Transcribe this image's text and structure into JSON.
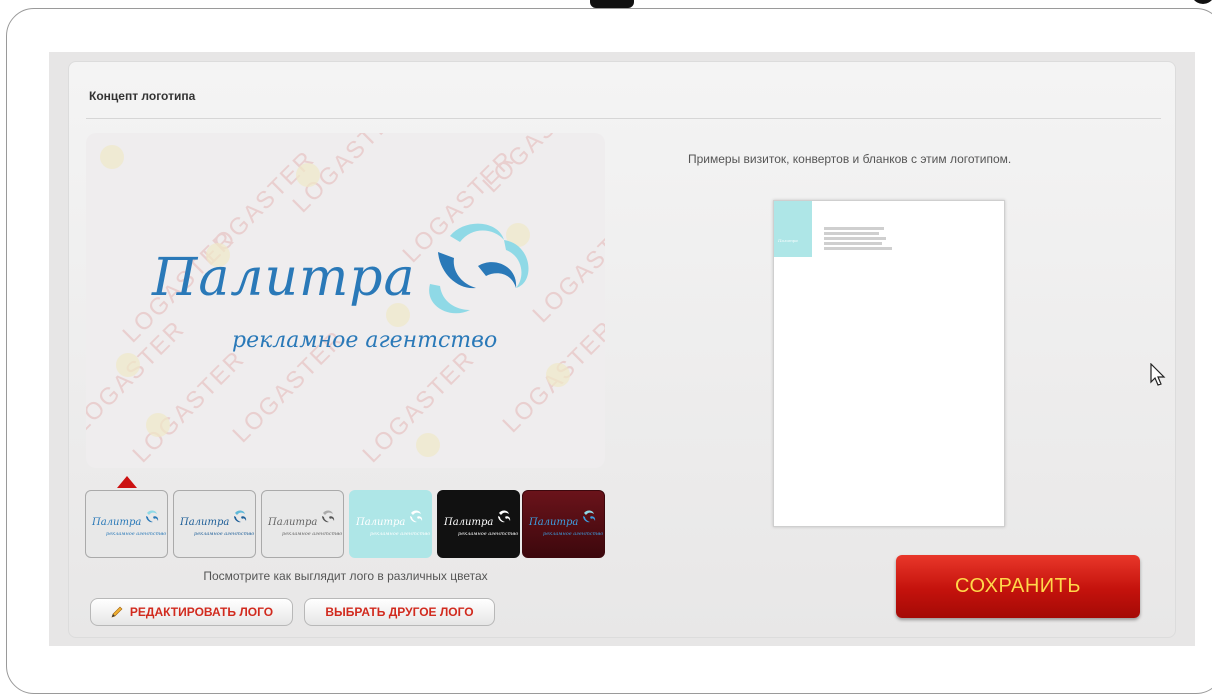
{
  "panel": {
    "title": "Концепт логотипа"
  },
  "preview": {
    "watermark_text": "LOGASTER",
    "logo_name": "Палитра",
    "logo_tagline": "рекламное агентство"
  },
  "variants": {
    "caption": "Посмотрите как выглядит лого в различных цветах",
    "items": [
      {
        "logo_name": "Палитра",
        "logo_tagline": "рекламное агентство",
        "background": "#e8e8e8",
        "text_color": "#2a79b8"
      },
      {
        "logo_name": "Палитра",
        "logo_tagline": "рекламное агентство",
        "background": "#e8e8e8",
        "text_color": "#1f5f98"
      },
      {
        "logo_name": "Палитра",
        "logo_tagline": "рекламное агентство",
        "background": "#e8e8e8",
        "text_color": "#666666"
      },
      {
        "logo_name": "Палитра",
        "logo_tagline": "рекламное агентство",
        "background": "#aee6e7",
        "text_color": "#ffffff"
      },
      {
        "logo_name": "Палитра",
        "logo_tagline": "рекламное агентство",
        "background": "#111111",
        "text_color": "#ffffff"
      },
      {
        "logo_name": "Палитра",
        "logo_tagline": "рекламное агентство",
        "background": "#5a0e14",
        "text_color": "#3d9fe0"
      }
    ],
    "selected_index": 0
  },
  "actions": {
    "edit_label": "РЕДАКТИРОВАТЬ ЛОГО",
    "choose_label": "ВЫБРАТЬ ДРУГОЕ ЛОГО",
    "save_label": "СОХРАНИТЬ"
  },
  "examples": {
    "caption": "Примеры визиток, конвертов и бланков с этим логотипом."
  },
  "colors": {
    "accent_red": "#cc1111",
    "logo_blue": "#2a79b8",
    "save_text": "#ffd84a"
  }
}
